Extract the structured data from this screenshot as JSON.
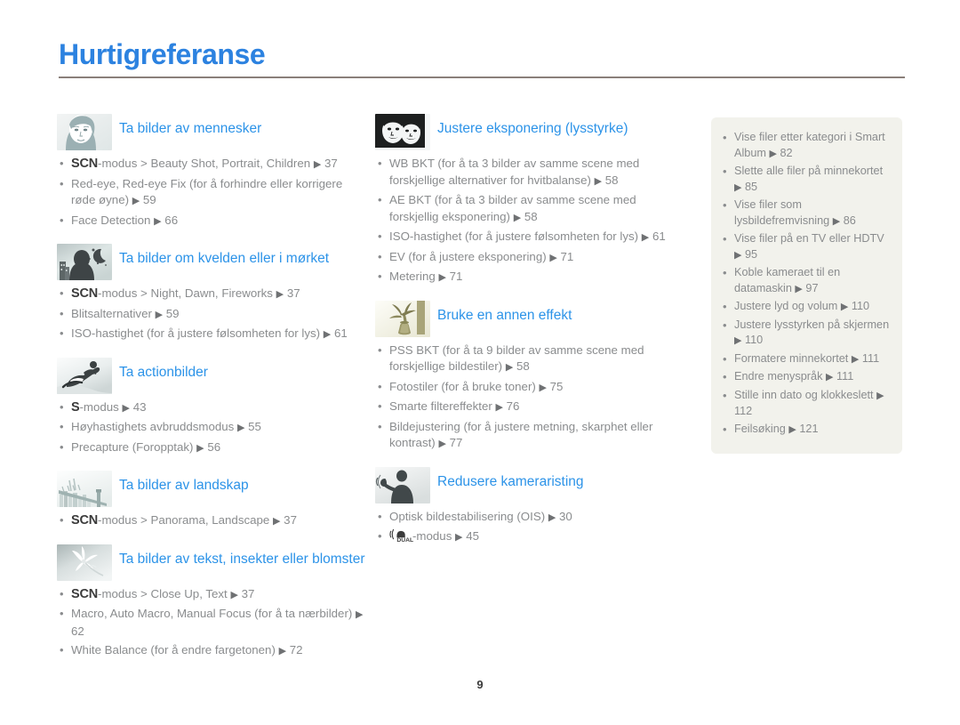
{
  "page": {
    "title": "Hurtigreferanse",
    "number": "9",
    "accent_color": "#2c82e0",
    "rule_color": "#8a7f7a",
    "sidebar_bg": "#f2f2ec",
    "body_text_color": "#8a8c8e"
  },
  "columns": [
    {
      "id": "column-1",
      "blocks": [
        {
          "icon": "portrait-face-icon",
          "title": "Ta bilder av mennesker",
          "items": [
            {
              "mode": "SCN",
              "text": "-modus > Beauty Shot, Portrait, Children",
              "page": "37"
            },
            {
              "mode": "",
              "text": "Red-eye, Red-eye Fix (for å forhindre eller korrigere røde øyne)",
              "page": "59"
            },
            {
              "mode": "",
              "text": "Face Detection",
              "page": "66"
            }
          ]
        },
        {
          "icon": "night-scene-icon",
          "title": "Ta bilder om kvelden eller i mørket",
          "items": [
            {
              "mode": "SCN",
              "text": "-modus > Night, Dawn, Fireworks",
              "page": "37"
            },
            {
              "mode": "",
              "text": "Blitsalternativer",
              "page": "59"
            },
            {
              "mode": "",
              "text": "ISO-hastighet (for å justere følsomheten for lys)",
              "page": "61"
            }
          ]
        },
        {
          "icon": "snowboarder-action-icon",
          "title": "Ta actionbilder",
          "items": [
            {
              "mode": "S",
              "text": "-modus",
              "page": "43"
            },
            {
              "mode": "",
              "text": "Høyhastighets avbruddsmodus",
              "page": "55"
            },
            {
              "mode": "",
              "text": "Precapture (Foropptak)",
              "page": "56"
            }
          ]
        },
        {
          "icon": "bridge-landscape-icon",
          "title": "Ta bilder av landskap",
          "items": [
            {
              "mode": "SCN",
              "text": "-modus > Panorama, Landscape",
              "page": "37"
            }
          ]
        },
        {
          "icon": "flower-macro-icon",
          "title": "Ta bilder av tekst, insekter eller blomster",
          "items": [
            {
              "mode": "SCN",
              "text": "-modus > Close Up, Text",
              "page": "37"
            },
            {
              "mode": "",
              "text": "Macro, Auto Macro, Manual Focus (for å ta nærbilder)",
              "page": "62"
            },
            {
              "mode": "",
              "text": "White Balance (for å endre fargetonen)",
              "page": "72"
            }
          ]
        }
      ]
    },
    {
      "id": "column-2",
      "blocks": [
        {
          "icon": "two-faces-exposure-icon",
          "title": "Justere eksponering (lysstyrke)",
          "items": [
            {
              "mode": "",
              "text": "WB BKT (for å ta 3 bilder av samme scene med forskjellige alternativer for hvitbalanse)",
              "page": "58"
            },
            {
              "mode": "",
              "text": "AE BKT (for å ta 3 bilder av samme scene med forskjellig eksponering)",
              "page": "58"
            },
            {
              "mode": "",
              "text": "ISO-hastighet (for å justere følsomheten for lys)",
              "page": "61"
            },
            {
              "mode": "",
              "text": "EV (for å justere eksponering)",
              "page": "71"
            },
            {
              "mode": "",
              "text": "Metering",
              "page": "71"
            }
          ]
        },
        {
          "icon": "vase-flowers-effect-icon",
          "title": "Bruke en annen effekt",
          "items": [
            {
              "mode": "",
              "text": "PSS BKT (for å ta 9 bilder av samme scene med forskjellige bildestiler)",
              "page": "58"
            },
            {
              "mode": "",
              "text": "Fotostiler (for å bruke toner)",
              "page": "75"
            },
            {
              "mode": "",
              "text": "Smarte filtereffekter",
              "page": "76"
            },
            {
              "mode": "",
              "text": "Bildejustering (for å justere metning, skarphet eller kontrast)",
              "page": "77"
            }
          ]
        },
        {
          "icon": "shaking-person-icon",
          "title": "Redusere kameraristing",
          "items": [
            {
              "mode": "",
              "text": "Optisk bildestabilisering (OIS)",
              "page": "30"
            },
            {
              "mode": "DUAL_ICON",
              "text": "-modus",
              "page": "45"
            }
          ]
        }
      ]
    }
  ],
  "sidebar": {
    "items": [
      {
        "text": "Vise filer etter kategori i Smart Album",
        "page": "82"
      },
      {
        "text": "Slette alle filer på minnekortet",
        "page": "85"
      },
      {
        "text": "Vise filer som lysbildefremvisning",
        "page": "86"
      },
      {
        "text": "Vise filer på en TV eller HDTV",
        "page": "95"
      },
      {
        "text": "Koble kameraet til en datamaskin",
        "page": "97"
      },
      {
        "text": "Justere lyd og volum",
        "page": "110"
      },
      {
        "text": "Justere lysstyrken på skjermen",
        "page": "110"
      },
      {
        "text": "Formatere minnekortet",
        "page": "111"
      },
      {
        "text": "Endre menyspråk",
        "page": "111"
      },
      {
        "text": "Stille inn dato og klokkeslett",
        "page": "112"
      },
      {
        "text": "Feilsøking",
        "page": "121"
      }
    ]
  }
}
